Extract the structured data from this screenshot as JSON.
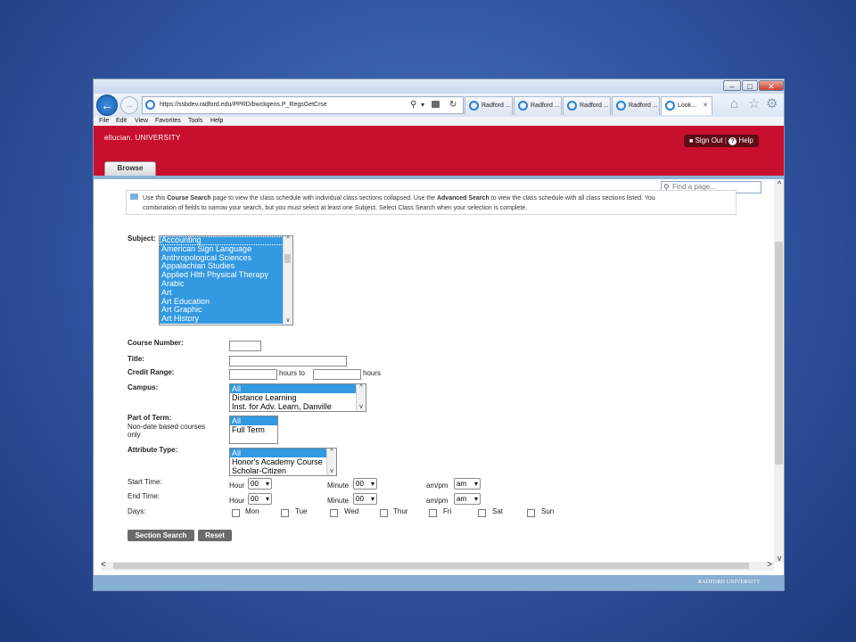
{
  "browser": {
    "window_buttons": [
      "–",
      "□",
      "✕"
    ],
    "address": "https://ssbdev.radford.edu/PPRD/bwckgens.P_RegsGetCrse",
    "tabs": [
      "Radford ...",
      "Radford ...",
      "Radford ...",
      "Radford ...",
      "Look..."
    ],
    "close_tab": "✕",
    "menu": [
      "File",
      "Edit",
      "View",
      "Favorites",
      "Tools",
      "Help"
    ]
  },
  "header": {
    "brand": "ellucian. UNIVERSITY",
    "sign_out": "Sign Out",
    "help": "Help",
    "browse_tab": "Browse",
    "find_placeholder": "Find a page..."
  },
  "info": {
    "text_1a": "Use this ",
    "text_1b": "Course Search",
    "text_1c": " page to view the class schedule with individual class sections collapsed. Use the ",
    "text_1d": "Advanced Search",
    "text_1e": " to view the class schedule with all class sections listed. You ",
    "text_2": "combination of fields to narrow your search, but you must select at least one Subject. Select Class Search when your selection is complete."
  },
  "form": {
    "subject_label": "Subject:",
    "subjects": [
      "Accounting",
      "American Sign Language",
      "Anthropological Sciences",
      "Appalachian Studies",
      "Applied Hlth Physical Therapy",
      "Arabic",
      "Art",
      "Art Education",
      "Art Graphic",
      "Art History"
    ],
    "course_number_label": "Course Number:",
    "title_label": "Title:",
    "credit_range_label": "Credit Range:",
    "hours_to": "hours to",
    "hours": "hours",
    "campus_label": "Campus:",
    "campus_options": [
      "All",
      "Distance Learning",
      "Inst. for Adv. Learn, Danville"
    ],
    "part_of_term_label": "Part of Term:",
    "part_of_term_note_1": "Non-date based courses",
    "part_of_term_note_2": "only",
    "part_of_term_options": [
      "All",
      "Full Term"
    ],
    "attribute_label": "Attribute Type:",
    "attribute_options": [
      "All",
      "Honor's Academy Course",
      "Scholar-Citizen"
    ],
    "start_time_label": "Start Time:",
    "end_time_label": "End Time:",
    "hour_label": "Hour",
    "minute_label": "Minute",
    "ampm_label": "am/pm",
    "start_hour": "00",
    "start_minute": "00",
    "start_ampm": "am",
    "end_hour": "00",
    "end_minute": "00",
    "end_ampm": "am",
    "days_label": "Days:",
    "days": [
      "Mon",
      "Tue",
      "Wed",
      "Thur",
      "Fri",
      "Sat",
      "Sun"
    ],
    "section_search_button": "Section Search",
    "reset_button": "Reset"
  },
  "footer": {
    "logo_text": "RADFORD UNIVERSITY"
  }
}
